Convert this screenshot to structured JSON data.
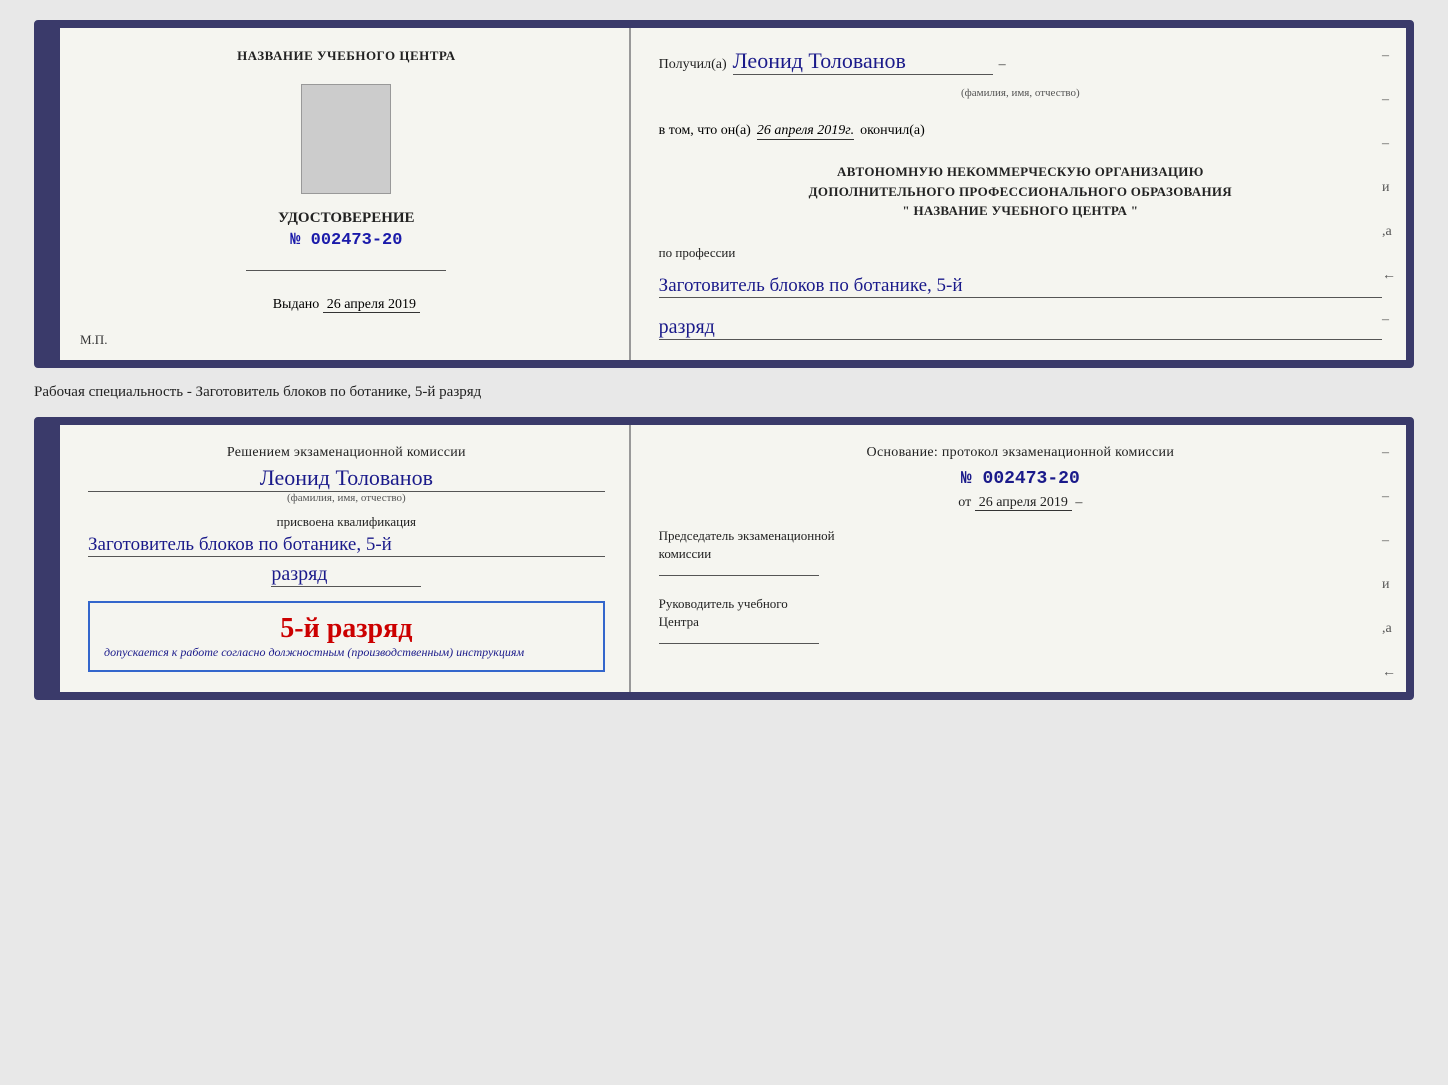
{
  "top_doc": {
    "left": {
      "center_title": "НАЗВАНИЕ УЧЕБНОГО ЦЕНТРА",
      "cert_title": "УДОСТОВЕРЕНИЕ",
      "cert_number": "№ 002473-20",
      "issued_label": "Выдано",
      "issued_date": "26 апреля 2019",
      "mp_label": "М.П."
    },
    "right": {
      "received_label": "Получил(а)",
      "received_name": "Леонид Толованов",
      "fio_subtitle": "(фамилия, имя, отчество)",
      "vtom_label": "в том, что он(а)",
      "vtom_date": "26 апреля 2019г.",
      "okonchill_label": "окончил(а)",
      "autonomous_line1": "АВТОНОМНУЮ НЕКОММЕРЧЕСКУЮ ОРГАНИЗАЦИЮ",
      "autonomous_line2": "ДОПОЛНИТЕЛЬНОГО ПРОФЕССИОНАЛЬНОГО ОБРАЗОВАНИЯ",
      "autonomous_line3": "\"  НАЗВАНИЕ УЧЕБНОГО ЦЕНТРА  \"",
      "po_professii_label": "по профессии",
      "profession": "Заготовитель блоков по ботанике, 5-й",
      "razryad": "разряд"
    }
  },
  "separator": {
    "text": "Рабочая специальность - Заготовитель блоков по ботанике, 5-й разряд"
  },
  "bottom_doc": {
    "left": {
      "resheniem_label": "Решением экзаменационной комиссии",
      "name": "Леонид Толованов",
      "fio_subtitle": "(фамилия, имя, отчество)",
      "prisvoena_label": "присвоена квалификация",
      "profession": "Заготовитель блоков по ботанике, 5-й",
      "razryad": "разряд",
      "stamp_razryad": "5-й разряд",
      "dopuskaetsya": "допускается к  работе согласно должностным (производственным) инструкциям"
    },
    "right": {
      "osnovanie_label": "Основание: протокол экзаменационной комиссии",
      "protocol_number": "№  002473-20",
      "ot_label": "от",
      "ot_date": "26 апреля 2019",
      "predsedatel_line1": "Председатель экзаменационной",
      "predsedatel_line2": "комиссии",
      "rukovoditel_line1": "Руководитель учебного",
      "rukovoditel_line2": "Центра"
    }
  },
  "right_dashes": [
    "–",
    "–",
    "–",
    "и",
    ",а",
    "←",
    "–",
    "–",
    "–",
    "–"
  ]
}
